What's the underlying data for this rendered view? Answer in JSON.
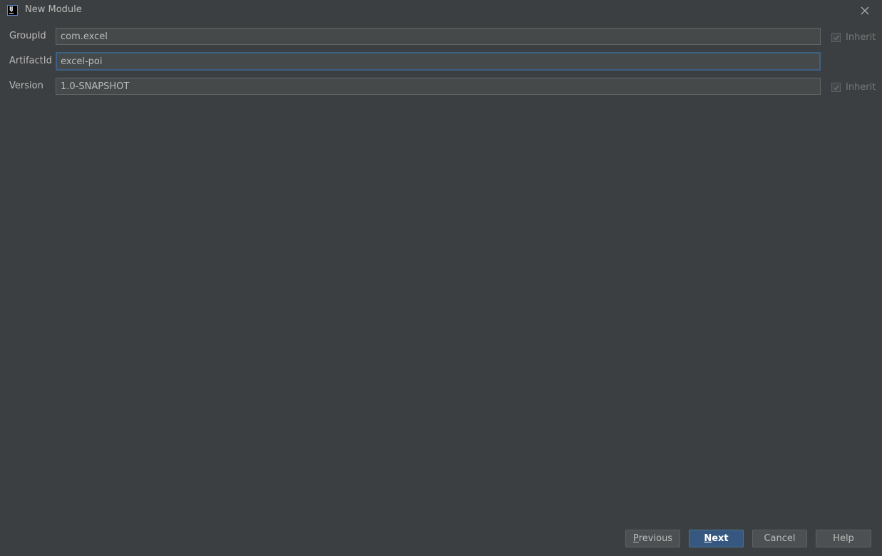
{
  "window": {
    "title": "New Module",
    "app_icon": "intellij-idea-icon",
    "close_icon": "close-icon"
  },
  "form": {
    "group_id": {
      "label": "GroupId",
      "value": "com.excel",
      "inherit_label": "Inherit",
      "inherit_checked": true
    },
    "artifact_id": {
      "label": "ArtifactId",
      "value": "excel-poi"
    },
    "version": {
      "label": "Version",
      "value": "1.0-SNAPSHOT",
      "inherit_label": "Inherit",
      "inherit_checked": true
    }
  },
  "buttons": {
    "previous": {
      "first": "P",
      "rest": "revious"
    },
    "next": {
      "first": "N",
      "rest": "ext"
    },
    "cancel": "Cancel",
    "help": "Help"
  },
  "colors": {
    "background": "#3c3f41",
    "field_background": "#45494a",
    "focus_border": "#3d6185",
    "default_button": "#365880"
  }
}
